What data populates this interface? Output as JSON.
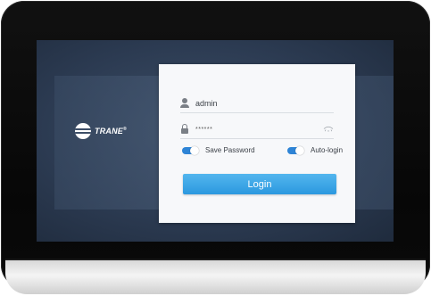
{
  "brand": {
    "name": "TRANE",
    "trademark": "®"
  },
  "login": {
    "username": "admin",
    "password_masked": "******",
    "save_password_label": "Save Password",
    "save_password_on": true,
    "auto_login_label": "Auto-login",
    "auto_login_on": true,
    "login_button_label": "Login"
  },
  "icons": {
    "user": "user-icon",
    "lock": "lock-icon",
    "eye": "eye-icon",
    "logo": "trane-logo-icon"
  },
  "colors": {
    "accent": "#2b98df",
    "toggle": "#2e84d6",
    "screen_bg": "#2c3b52",
    "panel_bg": "#f7f8fa"
  }
}
